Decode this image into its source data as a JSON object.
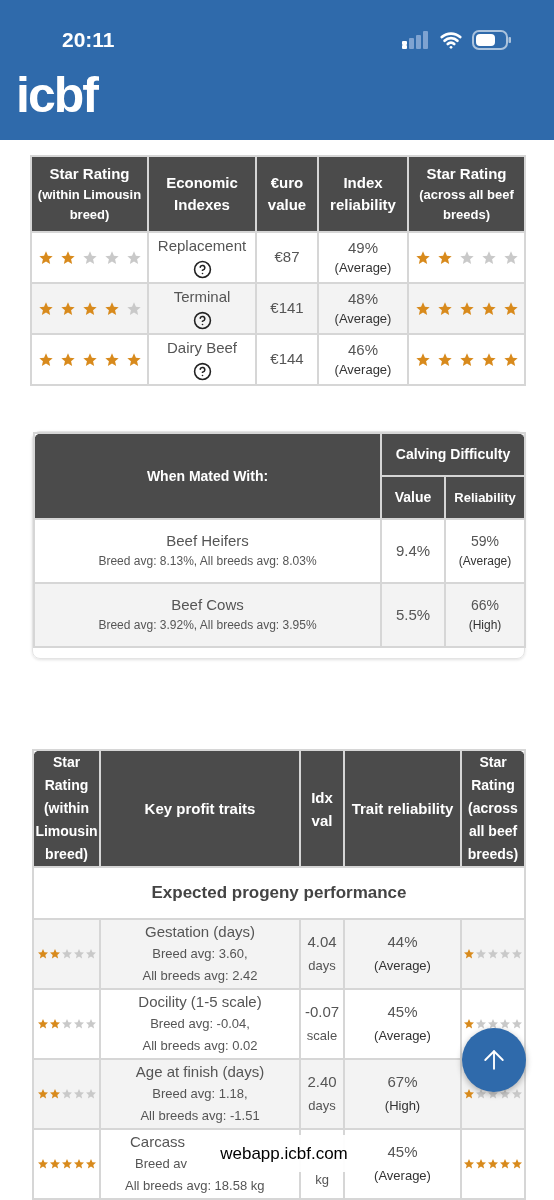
{
  "status_bar": {
    "time": "20:11"
  },
  "header": {
    "logo": "icbf"
  },
  "index_table": {
    "columns": [
      {
        "title": "Star Rating",
        "note": "(within Limousin breed)"
      },
      {
        "title": "Economic Indexes"
      },
      {
        "title": "€uro value"
      },
      {
        "title": "Index reliability"
      },
      {
        "title": "Star Rating",
        "note": "(across all beef breeds)"
      }
    ],
    "rows": [
      {
        "name": "Replacement",
        "value": "€87",
        "reliability": "49%",
        "reliability_label": "(Average)",
        "rating_within": {
          "stars": 2
        },
        "rating_across": {
          "stars": 2
        }
      },
      {
        "name": "Terminal",
        "value": "€141",
        "reliability": "48%",
        "reliability_label": "(Average)",
        "rating_within": {
          "stars": 4
        },
        "rating_across": {
          "stars": 5
        }
      },
      {
        "name": "Dairy Beef",
        "value": "€144",
        "reliability": "46%",
        "reliability_label": "(Average)",
        "rating_within": {
          "stars": 5
        },
        "rating_across": {
          "stars": 5
        }
      }
    ]
  },
  "calving_table": {
    "columns": {
      "mated_with": "When Mated With:",
      "group": "Calving Difficulty",
      "value": "Value",
      "reliability": "Reliability"
    },
    "rows": [
      {
        "name": "Beef Heifers",
        "averages": "Breed avg: 8.13%, All breeds avg: 8.03%",
        "value": "9.4%",
        "reliability": "59%",
        "reliability_label": "(Average)"
      },
      {
        "name": "Beef Cows",
        "averages": "Breed avg: 3.92%, All breeds avg: 3.95%",
        "value": "5.5%",
        "reliability": "66%",
        "reliability_label": "(High)"
      }
    ]
  },
  "traits_table": {
    "columns": [
      "Star Rating (within Limousin breed)",
      "Key profit traits",
      "Idx val",
      "Trait reliability",
      "Star Rating (across all beef breeds)"
    ],
    "section": "Expected progeny performance",
    "rows": [
      {
        "name": "Gestation (days)",
        "breed_avg": "Breed avg: 3.60,",
        "all_breeds_avg": "All breeds avg: 2.42",
        "value": "4.04",
        "unit": "days",
        "reliability": "44%",
        "reliability_label": "(Average)",
        "rating_within": {
          "stars": 2
        },
        "rating_across": {
          "stars": 1
        }
      },
      {
        "name": "Docility (1-5 scale)",
        "breed_avg": "Breed avg: -0.04,",
        "all_breeds_avg": "All breeds avg: 0.02",
        "value": "-0.07",
        "unit": "scale",
        "reliability": "45%",
        "reliability_label": "(Average)",
        "rating_within": {
          "stars": 2
        },
        "rating_across": {
          "stars": 1
        }
      },
      {
        "name": "Age at finish (days)",
        "breed_avg": "Breed avg: 1.18,",
        "all_breeds_avg": "All breeds avg: -1.51",
        "value": "2.40",
        "unit": "days",
        "reliability": "67%",
        "reliability_label": "(High)",
        "rating_within": {
          "stars": 2
        },
        "rating_across": {
          "stars": 1
        }
      },
      {
        "name": "Carcass",
        "breed_avg": "Breed av",
        "all_breeds_avg": "All breeds avg: 18.58 kg",
        "unit": "kg",
        "reliability": "45%",
        "reliability_label": "(Average)",
        "rating_within": {
          "stars": 5
        },
        "rating_across": {
          "stars": 5
        }
      }
    ]
  },
  "url_bar": {
    "url": "webapp.icbf.com"
  }
}
